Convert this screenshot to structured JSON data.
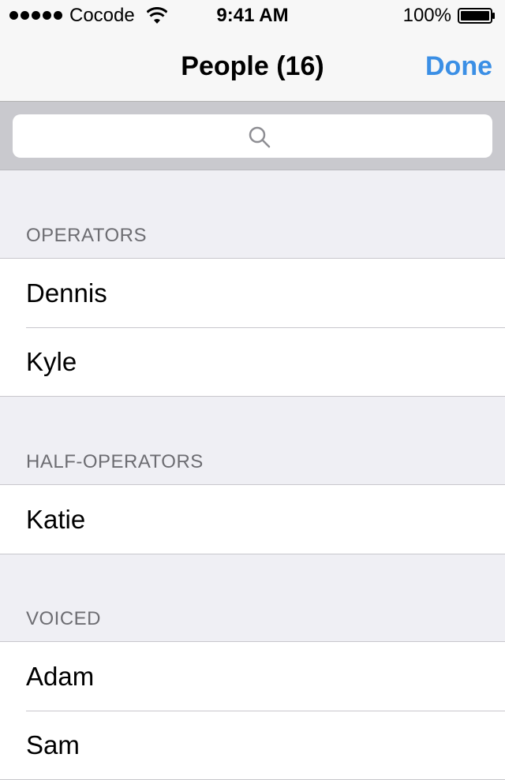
{
  "status_bar": {
    "carrier": "Cocode",
    "time": "9:41 AM",
    "battery": "100%"
  },
  "nav": {
    "title": "People (16)",
    "done_label": "Done"
  },
  "colors": {
    "accent": "#3b8fe5",
    "section_header_text": "#6d6d72",
    "background": "#efeff4"
  },
  "icons": [
    "signal-dots-icon",
    "wifi-icon",
    "battery-icon",
    "search-icon"
  ],
  "sections": [
    {
      "header": "OPERATORS",
      "items": [
        "Dennis",
        "Kyle"
      ]
    },
    {
      "header": "HALF-OPERATORS",
      "items": [
        "Katie"
      ]
    },
    {
      "header": "VOICED",
      "items": [
        "Adam",
        "Sam"
      ]
    }
  ]
}
